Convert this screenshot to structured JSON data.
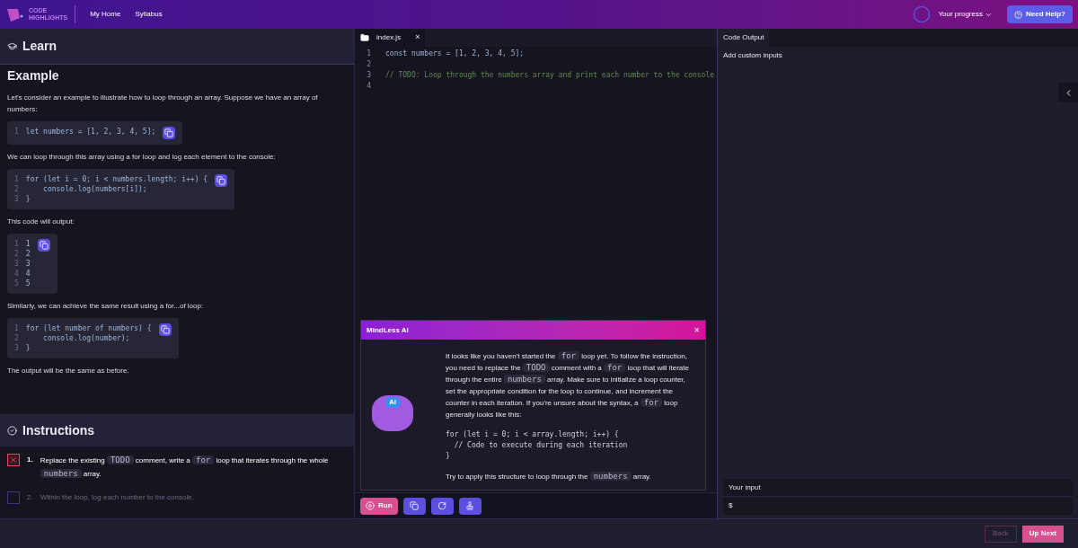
{
  "header": {
    "logo": [
      "CODE",
      "HIGHLIGHTS"
    ],
    "nav": [
      "My Home",
      "Syllabus"
    ],
    "progress": "Your progress",
    "help": "Need Help?"
  },
  "learn": {
    "title": "Learn",
    "heading": "Example",
    "blocks": [
      {
        "kind": "text",
        "text": "Let's consider an example to illustrate how to loop through an array. Suppose we have an array of numbers:"
      },
      {
        "kind": "code",
        "lines": [
          {
            "n": "1",
            "code": "let numbers = [1, 2, 3, 4, 5];"
          }
        ]
      },
      {
        "kind": "text",
        "text": "We can loop through this array using a for loop and log each element to the console:"
      },
      {
        "kind": "code",
        "lines": [
          {
            "n": "1",
            "code": "for (let i = 0; i < numbers.length; i++) {"
          },
          {
            "n": "2",
            "code": "    console.log(numbers[i]);"
          },
          {
            "n": "3",
            "code": "}"
          }
        ]
      },
      {
        "kind": "text",
        "text": "This code will output:"
      },
      {
        "kind": "code",
        "lines": [
          {
            "n": "1",
            "code": "1"
          },
          {
            "n": "2",
            "code": "2"
          },
          {
            "n": "3",
            "code": "3"
          },
          {
            "n": "4",
            "code": "4"
          },
          {
            "n": "5",
            "code": "5"
          }
        ]
      },
      {
        "kind": "text",
        "text": "Similarly, we can achieve the same result using a for...of loop:"
      },
      {
        "kind": "code",
        "lines": [
          {
            "n": "1",
            "code": "for (let number of numbers) {"
          },
          {
            "n": "2",
            "code": "    console.log(number);"
          },
          {
            "n": "3",
            "code": "}"
          }
        ]
      },
      {
        "kind": "text",
        "text": "The output will be the same as before."
      }
    ]
  },
  "instructions": {
    "title": "Instructions",
    "items": [
      {
        "number": "1.",
        "kind": "failed",
        "parts": [
          {
            "kind": "text",
            "text": "Replace the existing "
          },
          {
            "kind": "code",
            "text": "TODO"
          },
          {
            "kind": "text",
            "text": " comment, write a "
          },
          {
            "kind": "code",
            "text": "for"
          },
          {
            "kind": "text",
            "text": " loop that iterates through the whole "
          },
          {
            "kind": "code",
            "text": "numbers"
          },
          {
            "kind": "text",
            "text": " array."
          }
        ]
      },
      {
        "number": "2.",
        "kind": "pending",
        "parts": [
          {
            "kind": "text",
            "text": "Within the loop, log each number to the console."
          }
        ]
      }
    ]
  },
  "editor": {
    "tab": "index.js",
    "close": "×",
    "lines": [
      {
        "n": "1",
        "kind": "code",
        "text": "const numbers = [1, 2, 3, 4, 5];"
      },
      {
        "n": "2"
      },
      {
        "n": "3",
        "kind": "comment",
        "text": "// TODO: Loop through the numbers array and print each number to the console"
      },
      {
        "n": "4"
      }
    ]
  },
  "ai": {
    "title": "MindLess AI",
    "close": "×",
    "badge": "AI",
    "paragraphs": [
      [
        {
          "kind": "text",
          "text": "It looks like you haven't started the "
        },
        {
          "kind": "code",
          "text": "for"
        },
        {
          "kind": "text",
          "text": " loop yet. To follow the instruction, you need to replace the "
        },
        {
          "kind": "code",
          "text": "TODO"
        },
        {
          "kind": "text",
          "text": " comment with a "
        },
        {
          "kind": "code",
          "text": "for"
        },
        {
          "kind": "text",
          "text": " loop that will iterate through the entire "
        },
        {
          "kind": "code",
          "text": "numbers"
        },
        {
          "kind": "text",
          "text": " array. Make sure to initialize a loop counter, set the appropriate condition for the loop to continue, and increment the counter in each iteration. If you're unsure about the syntax, a "
        },
        {
          "kind": "code",
          "text": "for"
        },
        {
          "kind": "text",
          "text": " loop generally looks like this:"
        }
      ],
      [
        {
          "kind": "text",
          "text": "Try to apply this structure to loop through the "
        },
        {
          "kind": "code",
          "text": "numbers"
        },
        {
          "kind": "text",
          "text": " array."
        }
      ]
    ],
    "code": [
      "for (let i = 0; i < array.length; i++) {",
      "  // Code to execute during each iteration",
      "}"
    ]
  },
  "toolbar": {
    "run": "Run"
  },
  "output": {
    "tab": "Code Output",
    "custom": "Add custom inputs",
    "input_label": "Your input",
    "prompt": "$"
  },
  "footer": {
    "back": "Back",
    "next": "Up Next"
  }
}
